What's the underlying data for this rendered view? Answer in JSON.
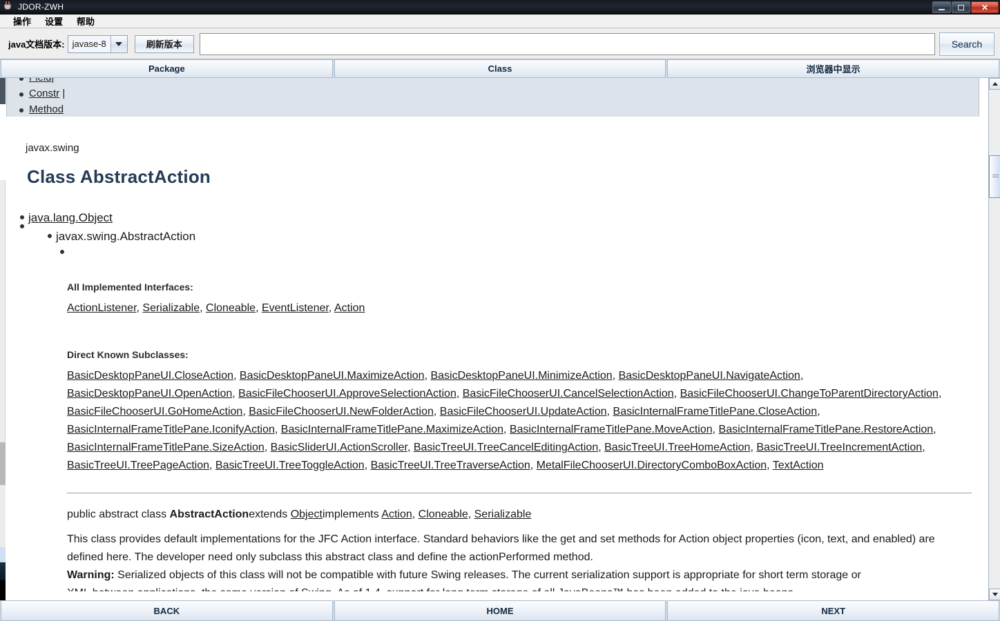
{
  "window": {
    "title": "JDOR-ZWH",
    "icon": "java-cup-icon",
    "buttons": {
      "minimize": "minimize-button",
      "maximize": "maximize-button",
      "close": "✕"
    }
  },
  "menubar": {
    "items": [
      "操作",
      "设置",
      "帮助"
    ]
  },
  "toolbar": {
    "version_label": "java文档版本:",
    "version_value": "javase-8",
    "refresh_label": "刷新版本",
    "search_value": "",
    "search_placeholder": "",
    "search_button": "Search"
  },
  "segbar": {
    "tabs": [
      "Package",
      "Class",
      "浏览器中显示"
    ]
  },
  "banner": {
    "items": [
      {
        "label": "Field",
        "suffix": "|"
      },
      {
        "label": "Constr",
        "suffix": "|"
      },
      {
        "label": "Method",
        "suffix": ""
      }
    ]
  },
  "doc": {
    "package": "javax.swing",
    "title": "Class AbstractAction",
    "tree": [
      {
        "label": "java.lang.Object",
        "link": true
      },
      {
        "label": "javax.swing.AbstractAction",
        "link": false
      }
    ],
    "interfaces_head": "All Implemented Interfaces:",
    "interfaces": [
      "ActionListener",
      "Serializable",
      "Cloneable",
      "EventListener",
      "Action"
    ],
    "subclasses_head": "Direct Known Subclasses:",
    "subclasses": [
      "BasicDesktopPaneUI.CloseAction",
      "BasicDesktopPaneUI.MaximizeAction",
      "BasicDesktopPaneUI.MinimizeAction",
      "BasicDesktopPaneUI.NavigateAction",
      "BasicDesktopPaneUI.OpenAction",
      "BasicFileChooserUI.ApproveSelectionAction",
      "BasicFileChooserUI.CancelSelectionAction",
      "BasicFileChooserUI.ChangeToParentDirectoryAction",
      "BasicFileChooserUI.GoHomeAction",
      "BasicFileChooserUI.NewFolderAction",
      "BasicFileChooserUI.UpdateAction",
      "BasicInternalFrameTitlePane.CloseAction",
      "BasicInternalFrameTitlePane.IconifyAction",
      "BasicInternalFrameTitlePane.MaximizeAction",
      "BasicInternalFrameTitlePane.MoveAction",
      "BasicInternalFrameTitlePane.RestoreAction",
      "BasicInternalFrameTitlePane.SizeAction",
      "BasicSliderUI.ActionScroller",
      "BasicTreeUI.TreeCancelEditingAction",
      "BasicTreeUI.TreeHomeAction",
      "BasicTreeUI.TreeIncrementAction",
      "BasicTreeUI.TreePageAction",
      "BasicTreeUI.TreeToggleAction",
      "BasicTreeUI.TreeTraverseAction",
      "MetalFileChooserUI.DirectoryComboBoxAction",
      "TextAction"
    ],
    "declaration": {
      "modifiers": "public abstract class ",
      "name": "AbstractAction",
      "extends_kw": "extends ",
      "super": "Object",
      "implements_kw": "implements ",
      "implements": [
        "Action",
        "Cloneable",
        "Serializable"
      ]
    },
    "description": [
      "This class provides default implementations for the JFC Action interface. Standard behaviors like the get and set methods for Action object properties (icon, text, and enabled) are defined here. The developer need only subclass this abstract class and define the actionPerformed method."
    ],
    "warning_label": "Warning:",
    "warning_text": " Serialized objects of this class will not be compatible with future Swing releases. The current serialization support is appropriate for short term storage or"
  },
  "bottombar": {
    "buttons": [
      "BACK",
      "HOME",
      "NEXT"
    ]
  },
  "colors": {
    "titlebar": "#20262f",
    "accent": "#233c56",
    "close_button": "#cf4433",
    "segment": "#dce6f1"
  }
}
